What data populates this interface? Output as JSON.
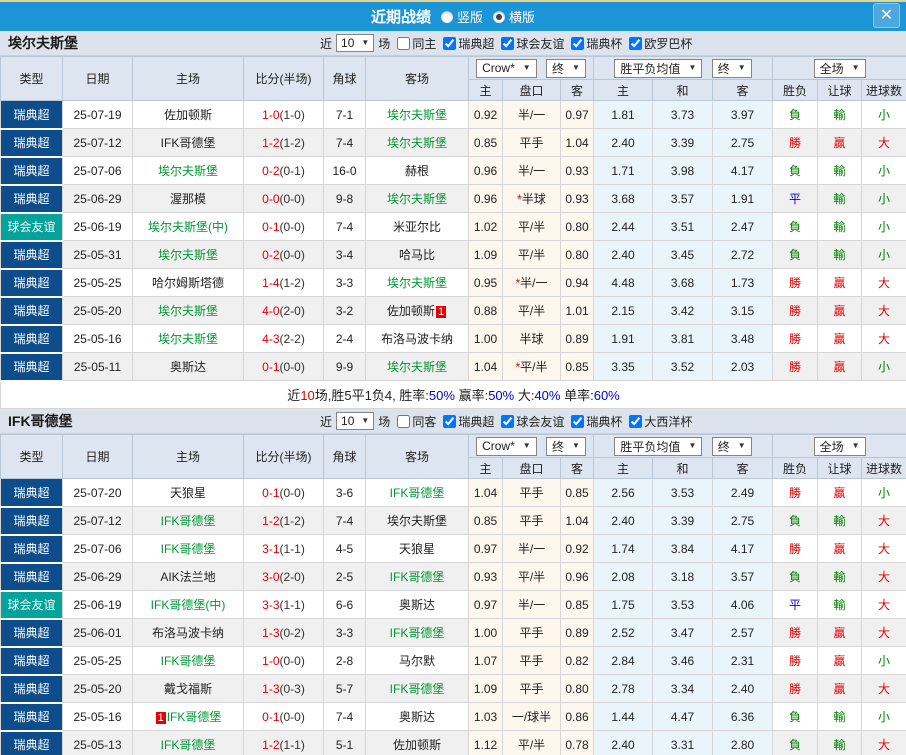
{
  "titlebar": {
    "title": "近期战绩",
    "radios": [
      {
        "label": "竖版",
        "selected": false
      },
      {
        "label": "横版",
        "selected": true
      }
    ],
    "close": "✕"
  },
  "table_header": {
    "cols": [
      "类型",
      "日期",
      "主场",
      "比分(半场)",
      "角球",
      "客场"
    ],
    "sub": [
      "主",
      "盘口",
      "客",
      "主",
      "和",
      "客",
      "胜负",
      "让球",
      "进球数"
    ],
    "dropdowns": {
      "crow": "Crow*",
      "final1": "终",
      "avg": "胜平负均值",
      "final2": "终",
      "full": "全场"
    }
  },
  "sections": [
    {
      "team": "埃尔夫斯堡",
      "filter": {
        "near": "近",
        "count": "10",
        "games": "场",
        "same": {
          "label": "同主",
          "checked": false
        },
        "leagues": [
          {
            "label": "瑞典超",
            "checked": true
          },
          {
            "label": "球会友谊",
            "checked": true
          },
          {
            "label": "瑞典杯",
            "checked": true
          },
          {
            "label": "欧罗巴杯",
            "checked": true
          }
        ]
      },
      "rows": [
        {
          "type": "瑞典超",
          "friendly": false,
          "date": "25-07-19",
          "home": "佐加顿斯",
          "home_green": false,
          "home_badge": "",
          "home_badge_pos": "",
          "score": "1-0",
          "half": "(1-0)",
          "corner": "7-1",
          "away": "埃尔夫斯堡",
          "away_green": true,
          "away_badge": "",
          "away_badge_pos": "",
          "crow_home": "0.92",
          "handicap": "半/一",
          "handicap_star": false,
          "crow_away": "0.97",
          "avg": [
            "1.81",
            "3.73",
            "3.97"
          ],
          "result": "負",
          "let": "輸",
          "goal": "小"
        },
        {
          "type": "瑞典超",
          "friendly": false,
          "date": "25-07-12",
          "home": "IFK哥德堡",
          "home_green": false,
          "home_badge": "",
          "home_badge_pos": "",
          "score": "1-2",
          "half": "(1-2)",
          "corner": "7-4",
          "away": "埃尔夫斯堡",
          "away_green": true,
          "away_badge": "",
          "away_badge_pos": "",
          "crow_home": "0.85",
          "handicap": "平手",
          "handicap_star": false,
          "crow_away": "1.04",
          "avg": [
            "2.40",
            "3.39",
            "2.75"
          ],
          "result": "勝",
          "let": "贏",
          "goal": "大"
        },
        {
          "type": "瑞典超",
          "friendly": false,
          "date": "25-07-06",
          "home": "埃尔夫斯堡",
          "home_green": true,
          "home_badge": "",
          "home_badge_pos": "",
          "score": "0-2",
          "half": "(0-1)",
          "corner": "16-0",
          "away": "赫根",
          "away_green": false,
          "away_badge": "",
          "away_badge_pos": "",
          "crow_home": "0.96",
          "handicap": "半/一",
          "handicap_star": false,
          "crow_away": "0.93",
          "avg": [
            "1.71",
            "3.98",
            "4.17"
          ],
          "result": "負",
          "let": "輸",
          "goal": "小"
        },
        {
          "type": "瑞典超",
          "friendly": false,
          "date": "25-06-29",
          "home": "渥那模",
          "home_green": false,
          "home_badge": "",
          "home_badge_pos": "",
          "score": "0-0",
          "half": "(0-0)",
          "corner": "9-8",
          "away": "埃尔夫斯堡",
          "away_green": true,
          "away_badge": "",
          "away_badge_pos": "",
          "crow_home": "0.96",
          "handicap": "半球",
          "handicap_star": true,
          "crow_away": "0.93",
          "avg": [
            "3.68",
            "3.57",
            "1.91"
          ],
          "result": "平",
          "let": "輸",
          "goal": "小"
        },
        {
          "type": "球会友谊",
          "friendly": true,
          "date": "25-06-19",
          "home": "埃尔夫斯堡(中)",
          "home_green": true,
          "home_badge": "",
          "home_badge_pos": "",
          "score": "0-1",
          "half": "(0-0)",
          "corner": "7-4",
          "away": "米亚尔比",
          "away_green": false,
          "away_badge": "",
          "away_badge_pos": "",
          "crow_home": "1.02",
          "handicap": "平/半",
          "handicap_star": false,
          "crow_away": "0.80",
          "avg": [
            "2.44",
            "3.51",
            "2.47"
          ],
          "result": "負",
          "let": "輸",
          "goal": "小"
        },
        {
          "type": "瑞典超",
          "friendly": false,
          "date": "25-05-31",
          "home": "埃尔夫斯堡",
          "home_green": true,
          "home_badge": "",
          "home_badge_pos": "",
          "score": "0-2",
          "half": "(0-0)",
          "corner": "3-4",
          "away": "哈马比",
          "away_green": false,
          "away_badge": "",
          "away_badge_pos": "",
          "crow_home": "1.09",
          "handicap": "平/半",
          "handicap_star": false,
          "crow_away": "0.80",
          "avg": [
            "2.40",
            "3.45",
            "2.72"
          ],
          "result": "負",
          "let": "輸",
          "goal": "小"
        },
        {
          "type": "瑞典超",
          "friendly": false,
          "date": "25-05-25",
          "home": "哈尔姆斯塔德",
          "home_green": false,
          "home_badge": "",
          "home_badge_pos": "",
          "score": "1-4",
          "half": "(1-2)",
          "corner": "3-3",
          "away": "埃尔夫斯堡",
          "away_green": true,
          "away_badge": "",
          "away_badge_pos": "",
          "crow_home": "0.95",
          "handicap": "半/一",
          "handicap_star": true,
          "crow_away": "0.94",
          "avg": [
            "4.48",
            "3.68",
            "1.73"
          ],
          "result": "勝",
          "let": "贏",
          "goal": "大"
        },
        {
          "type": "瑞典超",
          "friendly": false,
          "date": "25-05-20",
          "home": "埃尔夫斯堡",
          "home_green": true,
          "home_badge": "",
          "home_badge_pos": "",
          "score": "4-0",
          "half": "(2-0)",
          "corner": "3-2",
          "away": "佐加顿斯",
          "away_green": false,
          "away_badge": "1",
          "away_badge_pos": "after",
          "crow_home": "0.88",
          "handicap": "平/半",
          "handicap_star": false,
          "crow_away": "1.01",
          "avg": [
            "2.15",
            "3.42",
            "3.15"
          ],
          "result": "勝",
          "let": "贏",
          "goal": "大"
        },
        {
          "type": "瑞典超",
          "friendly": false,
          "date": "25-05-16",
          "home": "埃尔夫斯堡",
          "home_green": true,
          "home_badge": "",
          "home_badge_pos": "",
          "score": "4-3",
          "half": "(2-2)",
          "corner": "2-4",
          "away": "布洛马波卡纳",
          "away_green": false,
          "away_badge": "",
          "away_badge_pos": "",
          "crow_home": "1.00",
          "handicap": "半球",
          "handicap_star": false,
          "crow_away": "0.89",
          "avg": [
            "1.91",
            "3.81",
            "3.48"
          ],
          "result": "勝",
          "let": "贏",
          "goal": "大"
        },
        {
          "type": "瑞典超",
          "friendly": false,
          "date": "25-05-11",
          "home": "奥斯达",
          "home_green": false,
          "home_badge": "",
          "home_badge_pos": "",
          "score": "0-1",
          "half": "(0-0)",
          "corner": "9-9",
          "away": "埃尔夫斯堡",
          "away_green": true,
          "away_badge": "",
          "away_badge_pos": "",
          "crow_home": "1.04",
          "handicap": "平/半",
          "handicap_star": true,
          "crow_away": "0.85",
          "avg": [
            "3.35",
            "3.52",
            "2.03"
          ],
          "result": "勝",
          "let": "贏",
          "goal": "小"
        }
      ],
      "summary": [
        {
          "t": "近",
          "c": "k"
        },
        {
          "t": "10",
          "c": "r"
        },
        {
          "t": "场,胜5平1负4, 胜率:",
          "c": "k"
        },
        {
          "t": "50%",
          "c": "b"
        },
        {
          "t": " 赢率:",
          "c": "k"
        },
        {
          "t": "50%",
          "c": "b"
        },
        {
          "t": " 大:",
          "c": "k"
        },
        {
          "t": "40%",
          "c": "b"
        },
        {
          "t": " 单率:",
          "c": "k"
        },
        {
          "t": "60%",
          "c": "b"
        }
      ]
    },
    {
      "team": "IFK哥德堡",
      "filter": {
        "near": "近",
        "count": "10",
        "games": "场",
        "same": {
          "label": "同客",
          "checked": false
        },
        "leagues": [
          {
            "label": "瑞典超",
            "checked": true
          },
          {
            "label": "球会友谊",
            "checked": true
          },
          {
            "label": "瑞典杯",
            "checked": true
          },
          {
            "label": "大西洋杯",
            "checked": true
          }
        ]
      },
      "rows": [
        {
          "type": "瑞典超",
          "friendly": false,
          "date": "25-07-20",
          "home": "天狼星",
          "home_green": false,
          "home_badge": "",
          "home_badge_pos": "",
          "score": "0-1",
          "half": "(0-0)",
          "corner": "3-6",
          "away": "IFK哥德堡",
          "away_green": true,
          "away_badge": "",
          "away_badge_pos": "",
          "crow_home": "1.04",
          "handicap": "平手",
          "handicap_star": false,
          "crow_away": "0.85",
          "avg": [
            "2.56",
            "3.53",
            "2.49"
          ],
          "result": "勝",
          "let": "贏",
          "goal": "小"
        },
        {
          "type": "瑞典超",
          "friendly": false,
          "date": "25-07-12",
          "home": "IFK哥德堡",
          "home_green": true,
          "home_badge": "",
          "home_badge_pos": "",
          "score": "1-2",
          "half": "(1-2)",
          "corner": "7-4",
          "away": "埃尔夫斯堡",
          "away_green": false,
          "away_badge": "",
          "away_badge_pos": "",
          "crow_home": "0.85",
          "handicap": "平手",
          "handicap_star": false,
          "crow_away": "1.04",
          "avg": [
            "2.40",
            "3.39",
            "2.75"
          ],
          "result": "負",
          "let": "輸",
          "goal": "大"
        },
        {
          "type": "瑞典超",
          "friendly": false,
          "date": "25-07-06",
          "home": "IFK哥德堡",
          "home_green": true,
          "home_badge": "",
          "home_badge_pos": "",
          "score": "3-1",
          "half": "(1-1)",
          "corner": "4-5",
          "away": "天狼星",
          "away_green": false,
          "away_badge": "",
          "away_badge_pos": "",
          "crow_home": "0.97",
          "handicap": "半/一",
          "handicap_star": false,
          "crow_away": "0.92",
          "avg": [
            "1.74",
            "3.84",
            "4.17"
          ],
          "result": "勝",
          "let": "贏",
          "goal": "大"
        },
        {
          "type": "瑞典超",
          "friendly": false,
          "date": "25-06-29",
          "home": "AIK法兰地",
          "home_green": false,
          "home_badge": "",
          "home_badge_pos": "",
          "score": "3-0",
          "half": "(2-0)",
          "corner": "2-5",
          "away": "IFK哥德堡",
          "away_green": true,
          "away_badge": "",
          "away_badge_pos": "",
          "crow_home": "0.93",
          "handicap": "平/半",
          "handicap_star": false,
          "crow_away": "0.96",
          "avg": [
            "2.08",
            "3.18",
            "3.57"
          ],
          "result": "負",
          "let": "輸",
          "goal": "大"
        },
        {
          "type": "球会友谊",
          "friendly": true,
          "date": "25-06-19",
          "home": "IFK哥德堡(中)",
          "home_green": true,
          "home_badge": "",
          "home_badge_pos": "",
          "score": "3-3",
          "half": "(1-1)",
          "corner": "6-6",
          "away": "奥斯达",
          "away_green": false,
          "away_badge": "",
          "away_badge_pos": "",
          "crow_home": "0.97",
          "handicap": "半/一",
          "handicap_star": false,
          "crow_away": "0.85",
          "avg": [
            "1.75",
            "3.53",
            "4.06"
          ],
          "result": "平",
          "let": "輸",
          "goal": "大"
        },
        {
          "type": "瑞典超",
          "friendly": false,
          "date": "25-06-01",
          "home": "布洛马波卡纳",
          "home_green": false,
          "home_badge": "",
          "home_badge_pos": "",
          "score": "1-3",
          "half": "(0-2)",
          "corner": "3-3",
          "away": "IFK哥德堡",
          "away_green": true,
          "away_badge": "",
          "away_badge_pos": "",
          "crow_home": "1.00",
          "handicap": "平手",
          "handicap_star": false,
          "crow_away": "0.89",
          "avg": [
            "2.52",
            "3.47",
            "2.57"
          ],
          "result": "勝",
          "let": "贏",
          "goal": "大"
        },
        {
          "type": "瑞典超",
          "friendly": false,
          "date": "25-05-25",
          "home": "IFK哥德堡",
          "home_green": true,
          "home_badge": "",
          "home_badge_pos": "",
          "score": "1-0",
          "half": "(0-0)",
          "corner": "2-8",
          "away": "马尔默",
          "away_green": false,
          "away_badge": "",
          "away_badge_pos": "",
          "crow_home": "1.07",
          "handicap": "平手",
          "handicap_star": false,
          "crow_away": "0.82",
          "avg": [
            "2.84",
            "3.46",
            "2.31"
          ],
          "result": "勝",
          "let": "贏",
          "goal": "小"
        },
        {
          "type": "瑞典超",
          "friendly": false,
          "date": "25-05-20",
          "home": "戴戈福斯",
          "home_green": false,
          "home_badge": "",
          "home_badge_pos": "",
          "score": "1-3",
          "half": "(0-3)",
          "corner": "5-7",
          "away": "IFK哥德堡",
          "away_green": true,
          "away_badge": "",
          "away_badge_pos": "",
          "crow_home": "1.09",
          "handicap": "平手",
          "handicap_star": false,
          "crow_away": "0.80",
          "avg": [
            "2.78",
            "3.34",
            "2.40"
          ],
          "result": "勝",
          "let": "贏",
          "goal": "大"
        },
        {
          "type": "瑞典超",
          "friendly": false,
          "date": "25-05-16",
          "home": "IFK哥德堡",
          "home_green": true,
          "home_badge": "1",
          "home_badge_pos": "before",
          "score": "0-1",
          "half": "(0-0)",
          "corner": "7-4",
          "away": "奥斯达",
          "away_green": false,
          "away_badge": "",
          "away_badge_pos": "",
          "crow_home": "1.03",
          "handicap": "一/球半",
          "handicap_star": false,
          "crow_away": "0.86",
          "avg": [
            "1.44",
            "4.47",
            "6.36"
          ],
          "result": "負",
          "let": "輸",
          "goal": "小"
        },
        {
          "type": "瑞典超",
          "friendly": false,
          "date": "25-05-13",
          "home": "IFK哥德堡",
          "home_green": true,
          "home_badge": "",
          "home_badge_pos": "",
          "score": "1-2",
          "half": "(1-1)",
          "corner": "5-1",
          "away": "佐加顿斯",
          "away_green": false,
          "away_badge": "",
          "away_badge_pos": "",
          "crow_home": "1.12",
          "handicap": "平/半",
          "handicap_star": false,
          "crow_away": "0.78",
          "avg": [
            "2.40",
            "3.31",
            "2.80"
          ],
          "result": "負",
          "let": "輸",
          "goal": "大"
        }
      ],
      "summary": null
    }
  ]
}
